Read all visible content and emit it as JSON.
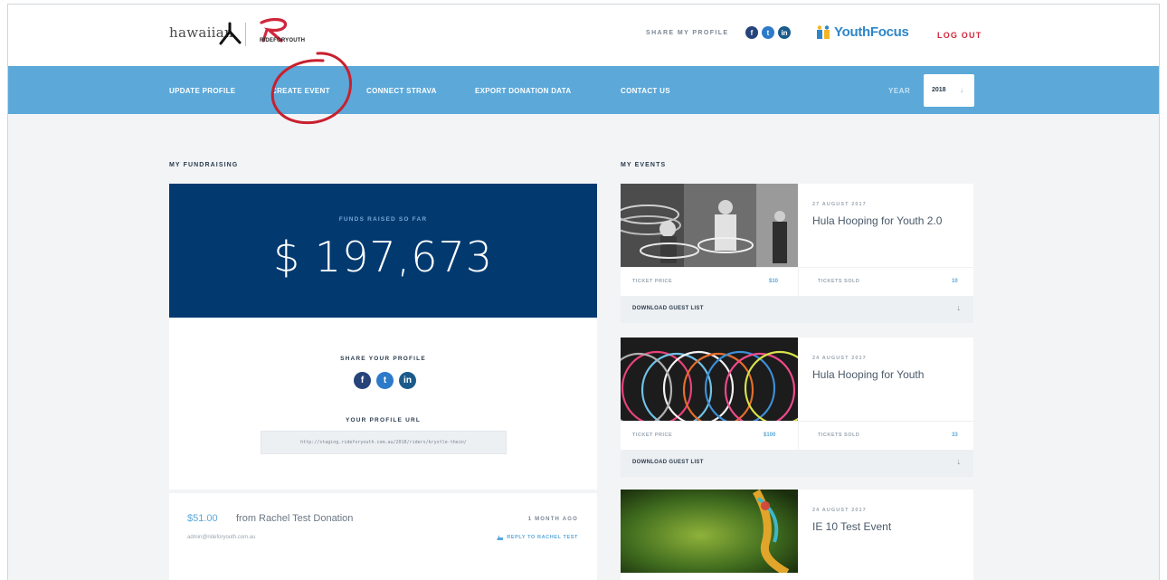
{
  "header": {
    "hawaiian_logo_text": "hawaiian",
    "rfy_logo_text": "RIDEFORYOUTH",
    "share_label": "SHARE MY PROFILE",
    "share_icons": [
      "facebook-icon",
      "twitter-icon",
      "linkedin-icon"
    ],
    "youthfocus_logo": "YouthFocus",
    "logout_label": "LOG OUT"
  },
  "nav": {
    "items": [
      {
        "label": "UPDATE PROFILE"
      },
      {
        "label": "CREATE EVENT"
      },
      {
        "label": "CONNECT STRAVA"
      },
      {
        "label": "EXPORT DONATION DATA"
      },
      {
        "label": "CONTACT US"
      }
    ],
    "year_label": "YEAR",
    "year_value": "2018",
    "year_arrow": "↓"
  },
  "fundraising": {
    "section_title": "MY FUNDRAISING",
    "funds_label": "FUNDS RAISED SO FAR",
    "funds_amount": "$ 197,673",
    "share_title": "SHARE YOUR PROFILE",
    "url_title": "YOUR PROFILE URL",
    "profile_url": "http://staging.rideforyouth.com.au/2018/riders/krystle-thein/",
    "donation": {
      "amount": "$51.00",
      "from": "from Rachel Test Donation",
      "email": "admin@rideforyouth.com.au",
      "time": "1 MONTH AGO",
      "reply": "REPLY TO RACHEL TEST"
    }
  },
  "events": {
    "section_title": "MY EVENTS",
    "ticket_price_label": "TICKET PRICE",
    "tickets_sold_label": "TICKETS SOLD",
    "download_label": "DOWNLOAD GUEST LIST",
    "download_arrow": "↓",
    "items": [
      {
        "date": "27 AUGUST 2017",
        "title": "Hula Hooping for Youth 2.0",
        "price": "$10",
        "sold": "10"
      },
      {
        "date": "24 AUGUST 2017",
        "title": "Hula Hooping for Youth",
        "price": "$100",
        "sold": "33"
      },
      {
        "date": "24 AUGUST 2017",
        "title": "IE 10 Test Event"
      }
    ]
  },
  "colors": {
    "nav_blue": "#5ba8d9",
    "funds_navy": "#023a70",
    "logout_red": "#d0263b",
    "annotation_red": "#c8202e"
  }
}
